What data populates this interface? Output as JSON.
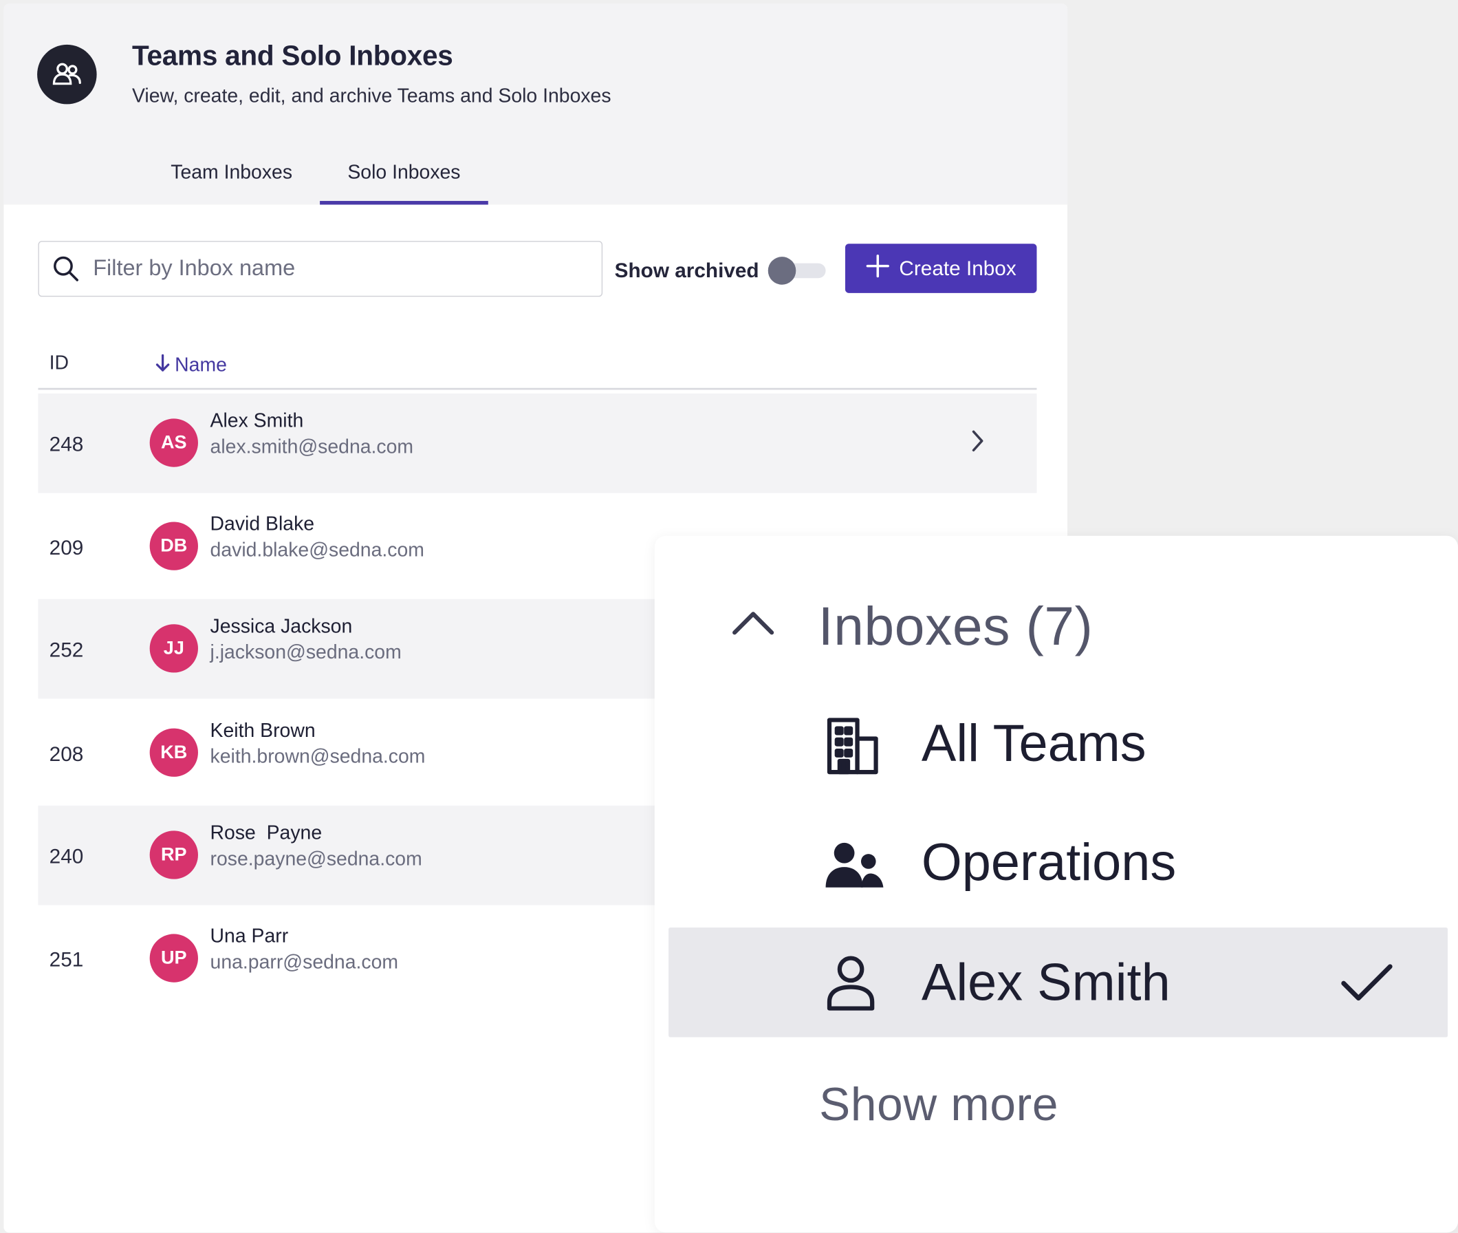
{
  "header": {
    "title": "Teams and Solo Inboxes",
    "subtitle": "View, create, edit, and archive Teams and Solo Inboxes",
    "avatar_icon": "people-icon"
  },
  "tabs": [
    {
      "label": "Team Inboxes",
      "active": false
    },
    {
      "label": "Solo Inboxes",
      "active": true
    }
  ],
  "toolbar": {
    "search_placeholder": "Filter by Inbox name",
    "search_value": "",
    "show_archived_label": "Show archived",
    "show_archived_on": false,
    "create_label": "Create Inbox"
  },
  "table": {
    "columns": {
      "id": "ID",
      "name": "Name",
      "name_sort": "descending"
    },
    "rows": [
      {
        "id": "248",
        "initials": "AS",
        "name": "Alex Smith",
        "email": "alex.smith@sedna.com"
      },
      {
        "id": "209",
        "initials": "DB",
        "name": "David Blake",
        "email": "david.blake@sedna.com"
      },
      {
        "id": "252",
        "initials": "JJ",
        "name": "Jessica Jackson",
        "email": "j.jackson@sedna.com"
      },
      {
        "id": "208",
        "initials": "KB",
        "name": "Keith Brown",
        "email": "keith.brown@sedna.com"
      },
      {
        "id": "240",
        "initials": "RP",
        "name": "Rose  Payne",
        "email": "rose.payne@sedna.com"
      },
      {
        "id": "251",
        "initials": "UP",
        "name": "Una Parr",
        "email": "una.parr@sedna.com"
      }
    ]
  },
  "dropdown": {
    "title": "Inboxes (7)",
    "items": [
      {
        "label": "All Teams",
        "icon": "building-icon",
        "selected": false
      },
      {
        "label": "Operations",
        "icon": "team-icon",
        "selected": false
      },
      {
        "label": "Alex Smith",
        "icon": "user-icon",
        "selected": true
      }
    ],
    "show_more": "Show more"
  },
  "colors": {
    "accent": "#4b37b5",
    "avatar": "#d7336d",
    "header_bg": "#f3f3f5"
  }
}
